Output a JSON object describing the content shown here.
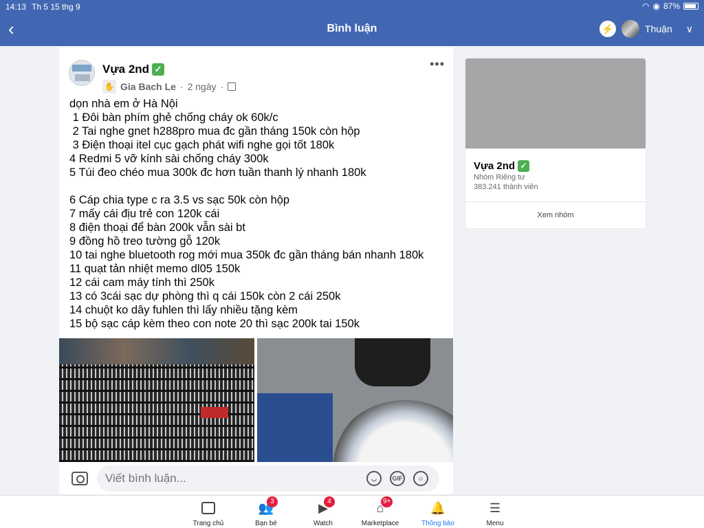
{
  "status_bar": {
    "time": "14:13",
    "date": "Th 5 15 thg 9",
    "battery": "87%"
  },
  "header": {
    "title": "Bình luận",
    "user_name": "Thuận"
  },
  "post": {
    "group_name": "Vựa 2nd",
    "author": "Gia Bach Le",
    "time": "2 ngày",
    "lines": [
      "dọn nhà em ở Hà Nội",
      " 1 Đôi bàn phím ghẻ chống cháy ok 60k/c",
      " 2 Tai nghe gnet h288pro mua đc gần tháng 150k còn hộp",
      " 3 Điện thoại itel cục gạch phát wifi nghe gọi tốt 180k",
      "4 Redmi 5 vỡ kính sài chống cháy 300k",
      "5 Túi đeo chéo mua 300k đc hơn tuần thanh lý nhanh 180k",
      "",
      "6 Cáp chia type c ra 3.5 vs sạc 50k còn hộp",
      "7 mấy cái địu trẻ con 120k cái",
      "8 điện thoại để bàn 200k vẫn sài bt",
      "9 đồng hồ treo tường gỗ 120k",
      "10 tai nghe bluetooth rog mới mua 350k đc gần tháng bán nhanh 180k",
      "11 quạt tản nhiệt memo dl05 150k",
      "12 cái cam máy tính thì 250k",
      "13 có 3cái sạc dự phòng thì q cái 150k còn 2 cái 250k",
      "14 chuột ko dây fuhlen thì lấy nhiều tặng kèm",
      "15 bộ sạc cáp kèm theo con note 20 thì sạc 200k tai 150k"
    ]
  },
  "comment": {
    "placeholder": "Viết bình luận..."
  },
  "group_card": {
    "name": "Vựa 2nd",
    "type": "Nhóm Riêng tư",
    "members": "383.241 thành viên",
    "button": "Xem nhóm"
  },
  "nav": {
    "items": [
      {
        "label": "Trang chủ",
        "icon": "home-icon",
        "badge": ""
      },
      {
        "label": "Bạn bè",
        "icon": "friends-icon",
        "badge": "3"
      },
      {
        "label": "Watch",
        "icon": "watch-icon",
        "badge": "4"
      },
      {
        "label": "Marketplace",
        "icon": "marketplace-icon",
        "badge": "9+"
      },
      {
        "label": "Thông báo",
        "icon": "bell-icon",
        "badge": ""
      },
      {
        "label": "Menu",
        "icon": "menu-icon",
        "badge": ""
      }
    ]
  },
  "colors": {
    "header": "#4267b2",
    "active": "#1877f2",
    "badge": "#e41e3f",
    "check": "#4caf50"
  }
}
